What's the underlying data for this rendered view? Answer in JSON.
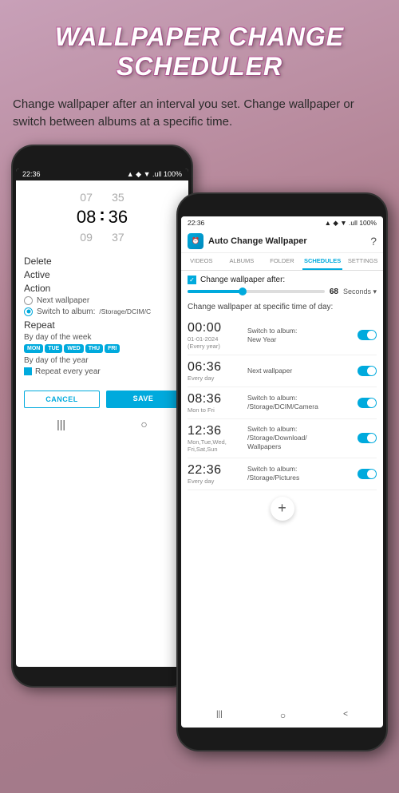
{
  "page": {
    "title_line1": "WALLPAPER CHANGE",
    "title_line2": "SCHEDULER",
    "subtitle": "Change wallpaper after an interval you set. Change wallpaper or switch between albums at a specific time."
  },
  "left_phone": {
    "status_time": "22:36",
    "status_icons": "▲ ◆ ▼ .ull 100%",
    "time_picker": {
      "col1": [
        "07",
        "08",
        "09"
      ],
      "col2": [
        "35",
        "36",
        "37"
      ],
      "active_col1": "08",
      "active_col2": "36"
    },
    "labels": {
      "delete": "Delete",
      "active": "Active",
      "action": "Action",
      "next_wallpaper": "Next wallpaper",
      "switch_to_album": "Switch to album:",
      "path": "/Storage/DCIM/C",
      "repeat": "Repeat",
      "by_day_week": "By day of the week",
      "by_day_year": "By day of the year",
      "repeat_every_year": "Repeat every year"
    },
    "days": [
      "MON",
      "TUE",
      "WED",
      "THU",
      "FRI"
    ],
    "buttons": {
      "cancel": "CANCEL",
      "save": "SAVE"
    }
  },
  "right_phone": {
    "status_time": "22:36",
    "status_icons": "▲ ◆ ▼ .ull 100%",
    "app_name": "Auto Change Wallpaper",
    "tabs": [
      "VIDEOS",
      "ALBUMS",
      "FOLDER",
      "SCHEDULES",
      "SETTINGS"
    ],
    "active_tab": "SCHEDULES",
    "change_after_label": "Change wallpaper after:",
    "slider_value": "68",
    "slider_unit": "Seconds",
    "specific_time_label": "Change wallpaper at specific time of day:",
    "schedules": [
      {
        "time": "00:00",
        "date": "01-01-2024",
        "repeat": "(Every year)",
        "action": "Switch to album:\nNew Year",
        "enabled": true
      },
      {
        "time": "06:36",
        "date": "",
        "repeat": "Every day",
        "action": "Next wallpaper",
        "enabled": true
      },
      {
        "time": "08:36",
        "date": "",
        "repeat": "Mon to Fri",
        "action": "Switch to album:\n/Storage/DCIM/Camera",
        "enabled": true
      },
      {
        "time": "12:36",
        "date": "",
        "repeat": "Mon,Tue,Wed,\nFri,Sat,Sun",
        "action": "Switch to album:\n/Storage/Download/\nWallpapers",
        "enabled": true
      },
      {
        "time": "22:36",
        "date": "",
        "repeat": "Every day",
        "action": "Switch to album:\n/Storage/Pictures",
        "enabled": true
      }
    ],
    "fab_label": "+",
    "nav": [
      "|||",
      "○",
      "<"
    ]
  }
}
